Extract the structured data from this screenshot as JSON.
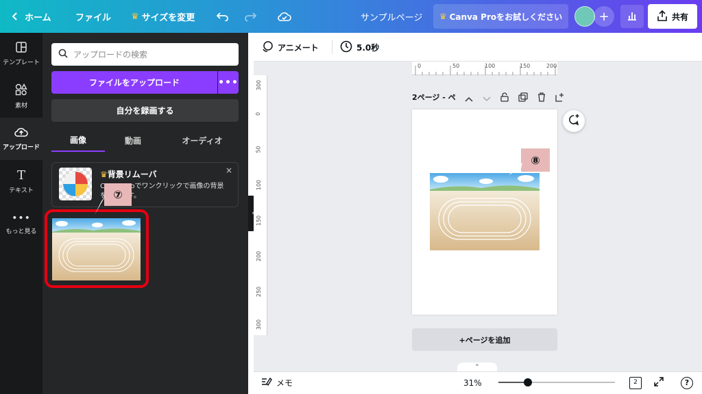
{
  "header": {
    "home": "ホーム",
    "file": "ファイル",
    "resize": "サイズを変更",
    "doc_title": "サンプルページ",
    "pro_trial": "Canva Proをお試しください",
    "share": "共有",
    "colors": {
      "brand_purple": "#8b3dff",
      "header_from": "#10b9c6",
      "header_to": "#6a3df0"
    }
  },
  "rail": {
    "items": [
      {
        "label": "テンプレート",
        "icon": "template-icon"
      },
      {
        "label": "素材",
        "icon": "elements-icon"
      },
      {
        "label": "アップロード",
        "icon": "upload-icon"
      },
      {
        "label": "テキスト",
        "icon": "text-icon"
      },
      {
        "label": "もっと見る",
        "icon": "more-icon"
      }
    ]
  },
  "panel": {
    "search_placeholder": "アップロードの検索",
    "upload_button": "ファイルをアップロード",
    "more_button": "•••",
    "record_button": "自分を録画する",
    "tabs": [
      {
        "label": "画像"
      },
      {
        "label": "動画"
      },
      {
        "label": "オーディオ"
      }
    ],
    "bg_remover": {
      "title": "背景リムーバ",
      "desc": "Canva Proでワンクリックで画像の背景を消せます。",
      "close": "×"
    }
  },
  "toolbar": {
    "animate": "アニメート",
    "duration": "5.0秒"
  },
  "ruler": {
    "top_ticks": [
      "0",
      "50",
      "100",
      "150",
      "200"
    ],
    "left_ticks": [
      "300",
      "0",
      "50",
      "100",
      "150",
      "200",
      "250",
      "300"
    ]
  },
  "page": {
    "label": "2ページ - ペ"
  },
  "add_page": "+ページを追加",
  "bottom": {
    "notes": "メモ",
    "zoom": "31%",
    "zoom_fraction": 0.31,
    "page_count": "2",
    "help": "?"
  },
  "annotations": {
    "callout_7": "⑦",
    "callout_8": "⑧"
  }
}
